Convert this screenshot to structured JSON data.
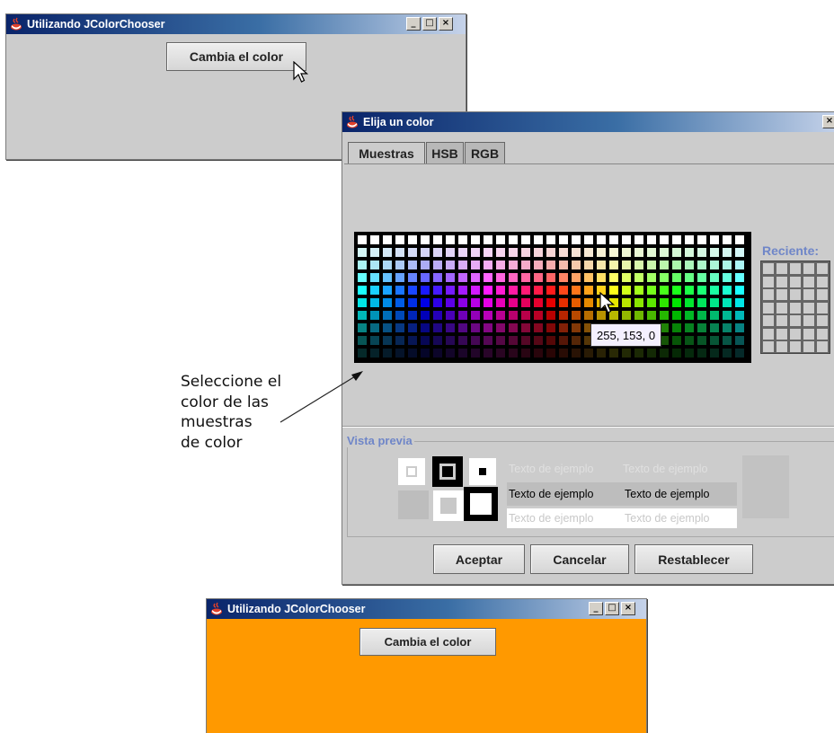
{
  "windows": {
    "before": {
      "title": "Utilizando JColorChooser",
      "button_label": "Cambia el color",
      "background": "#cccccc",
      "controls": [
        "_",
        "□",
        "×"
      ]
    },
    "dialog": {
      "title": "Elija un color",
      "close": "×",
      "tabs": [
        {
          "label": "Muestras",
          "active": true
        },
        {
          "label": "HSB",
          "active": false
        },
        {
          "label": "RGB",
          "active": false
        }
      ],
      "recent_label": "Reciente:",
      "tooltip": "255, 153, 0",
      "preview": {
        "legend": "Vista previa",
        "sample_text": "Texto de ejemplo"
      },
      "buttons": {
        "accept": "Aceptar",
        "cancel": "Cancelar",
        "reset": "Restablecer"
      }
    },
    "after": {
      "title": "Utilizando JColorChooser",
      "button_label": "Cambia el color",
      "background": "#ff9900",
      "controls": [
        "_",
        "□",
        "×"
      ]
    }
  },
  "annotation": {
    "lines": [
      "Seleccione el",
      "color de las",
      "muestras",
      "de color"
    ]
  },
  "colors": {
    "window_bg": "#cccccc",
    "selected_color": "#ff9900",
    "accent_label": "#6f86c8"
  },
  "icons": [
    "java-cup-icon",
    "minimize-icon",
    "maximize-icon",
    "close-icon",
    "mouse-cursor-icon"
  ]
}
